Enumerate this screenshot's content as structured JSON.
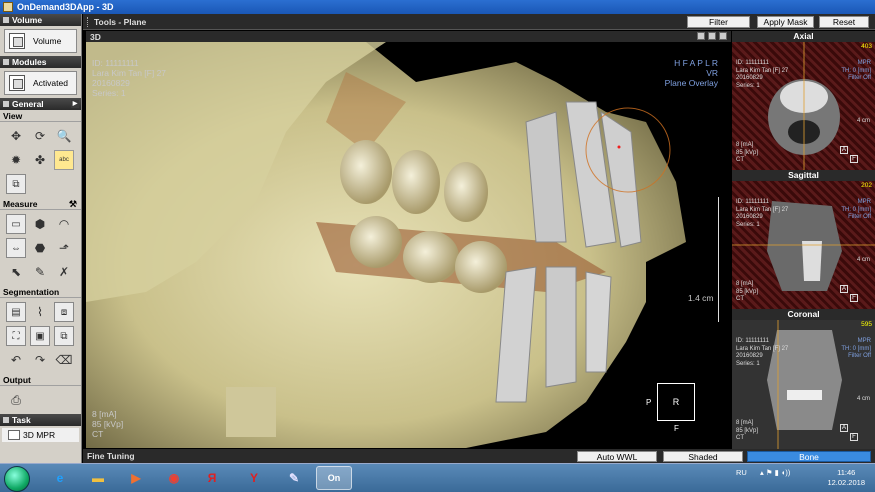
{
  "window": {
    "title": "OnDemand3DApp - 3D"
  },
  "left_panel": {
    "volume": {
      "header": "Volume",
      "button_label": "Volume"
    },
    "modules": {
      "header": "Modules",
      "button_label": "Activated"
    },
    "general": {
      "header": "General",
      "view_label": "View",
      "view_tools": [
        "move-icon",
        "rotate-icon",
        "zoom-icon",
        "window-level-icon",
        "pan-icon",
        "annotation-text-icon",
        "reset-view-icon"
      ],
      "annotation_text": "abc"
    },
    "measure": {
      "header": "Measure",
      "tools": [
        "ruler-icon",
        "volume-measure-icon",
        "angle-icon",
        "window-width-icon",
        "profile-icon",
        "arrow-annotation-icon",
        "pointer-icon",
        "pencil-icon",
        "delete-measure-icon"
      ]
    },
    "segmentation": {
      "header": "Segmentation",
      "tools": [
        "region-icon",
        "sculpt-icon",
        "clone-icon",
        "crop-icon",
        "cut-box-icon",
        "copy-icon",
        "undo-icon",
        "redo-icon",
        "eraser-icon"
      ]
    },
    "output": {
      "header": "Output"
    },
    "task": {
      "header": "Task",
      "item_label": "3D MPR"
    }
  },
  "tools_bar": {
    "title": "Tools - Plane",
    "buttons": {
      "filter": "Filter",
      "apply_mask": "Apply Mask",
      "reset": "Reset"
    }
  },
  "viewport3d": {
    "header": "3D",
    "patient_info": [
      "ID: 11111111",
      "Lara Kim Tan [F] 27",
      "20160829",
      "Series: 1"
    ],
    "orientation_text": "H F A P L R",
    "render_mode": "VR",
    "overlay_mode": "Plane Overlay",
    "scale_label": "1.4 cm",
    "exposure": [
      "8 [mA]",
      "85 [kVp]",
      "CT"
    ],
    "cube": {
      "face": "R",
      "left": "P",
      "bottom": "F"
    }
  },
  "right_panel": {
    "views": [
      {
        "name": "Axial",
        "slice": "403",
        "bottom": "F",
        "right_box": "A"
      },
      {
        "name": "Sagittal",
        "slice": "202",
        "bottom": "F",
        "right_box": "A"
      },
      {
        "name": "Coronal",
        "slice": "595",
        "bottom": "F",
        "right_box": "A"
      }
    ],
    "info": [
      "ID: 11111111",
      "Lara Kim Tan [F] 27",
      "20160829",
      "Series: 1"
    ],
    "mpr_info": [
      "MPR",
      "TH: 0 [mm]",
      "Filter Off"
    ],
    "scale": "4 cm",
    "exposure": [
      "8 [mA]",
      "85 [kVp]",
      "CT"
    ]
  },
  "bottom_bar": {
    "title": "Fine Tuning",
    "buttons": {
      "auto_wwl": "Auto WWL",
      "shaded": "Shaded",
      "bone": "Bone"
    }
  },
  "taskbar": {
    "apps": [
      "ie-icon",
      "explorer-icon",
      "media-player-icon",
      "chrome-icon",
      "yandex-music-icon",
      "yandex-browser-icon",
      "paint-icon",
      "ondemand3d-icon"
    ],
    "yandex_music_text": "Я",
    "yandex_browser_text": "Y",
    "ondemand_text": "On",
    "lang": "RU",
    "time": "11:46",
    "date": "12.02.2018"
  }
}
